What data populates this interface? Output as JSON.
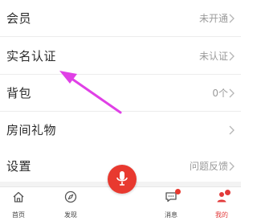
{
  "menu": {
    "items": [
      {
        "label": "会员",
        "value": "未开通"
      },
      {
        "label": "实名认证",
        "value": "未认证"
      },
      {
        "label": "背包",
        "value": "0个"
      },
      {
        "label": "房间礼物",
        "value": ""
      },
      {
        "label": "设置",
        "value": "问题反馈"
      }
    ]
  },
  "tabbar": {
    "tabs": [
      {
        "label": "首页",
        "icon": "home-icon"
      },
      {
        "label": "发现",
        "icon": "compass-icon"
      },
      {
        "label": "",
        "icon": "microphone-icon"
      },
      {
        "label": "消息",
        "icon": "message-icon"
      },
      {
        "label": "我的",
        "icon": "person-icon"
      }
    ],
    "active_color": "#e23a3a"
  },
  "colors": {
    "accent": "#e8392f",
    "annotation_arrow": "#e040e6"
  }
}
